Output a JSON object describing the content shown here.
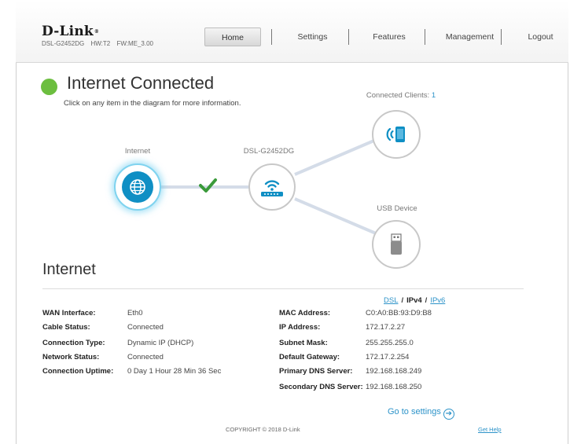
{
  "header": {
    "logo": "D-Link",
    "model": "DSL-G2452DG",
    "hw": "HW:T2",
    "fw": "FW:ME_3.00",
    "nav": [
      "Home",
      "Settings",
      "Features",
      "Management",
      "Logout"
    ],
    "active_nav": "Home"
  },
  "status": {
    "title": "Internet Connected",
    "subtitle": "Click on any item in the diagram for more information.",
    "color": "#6cbe3f"
  },
  "diagram": {
    "internet_label": "Internet",
    "router_label": "DSL-G2452DG",
    "clients_label": "Connected Clients:",
    "clients_count": "1",
    "usb_label": "USB Device",
    "link_icon": "checkmark-icon",
    "accent": "#0f8fc4"
  },
  "section": {
    "title": "Internet",
    "tabs": {
      "dsl": "DSL",
      "ipv4": "IPv4",
      "ipv6": "IPv6",
      "separator": "/"
    },
    "left": [
      {
        "label": "WAN Interface:",
        "value": "Eth0"
      },
      {
        "label": "Cable Status:",
        "value": "Connected"
      },
      {
        "label": "Connection Type:",
        "value": "Dynamic IP (DHCP)"
      },
      {
        "label": "Network Status:",
        "value": "Connected"
      },
      {
        "label": "Connection Uptime:",
        "value": "0 Day 1 Hour 28 Min 36 Sec"
      }
    ],
    "right": [
      {
        "label": "MAC Address:",
        "value": "C0:A0:BB:93:D9:B8"
      },
      {
        "label": "IP Address:",
        "value": "172.17.2.27"
      },
      {
        "label": "Subnet Mask:",
        "value": "255.255.255.0"
      },
      {
        "label": "Default Gateway:",
        "value": "172.17.2.254"
      },
      {
        "label": "Primary DNS Server:",
        "value": "192.168.168.249"
      },
      {
        "label": "Secondary DNS Server:",
        "value": "192.168.168.250"
      }
    ],
    "goto_settings": "Go to settings"
  },
  "footer": {
    "copyright": "COPYRIGHT © 2018 D-Link",
    "help": "Get Help"
  }
}
